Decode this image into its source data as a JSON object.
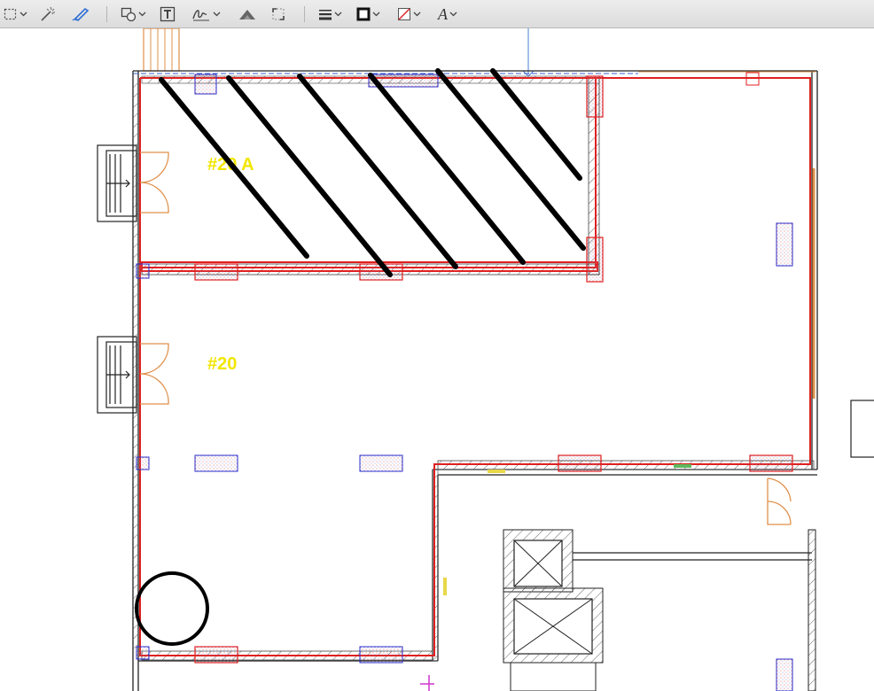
{
  "toolbar": {
    "tools": [
      {
        "name": "selection-tool",
        "icon": "dashed-rect-selection-icon",
        "has_menu": true
      },
      {
        "name": "instant-alpha-tool",
        "icon": "magic-wand-icon",
        "has_menu": false
      },
      {
        "name": "sketch-tool",
        "icon": "pen-sketch-icon",
        "has_menu": false,
        "active": true
      },
      {
        "name": "shapes-tool",
        "icon": "shapes-icon",
        "has_menu": true
      },
      {
        "name": "text-tool",
        "icon": "text-box-icon",
        "has_menu": false
      },
      {
        "name": "sign-tool",
        "icon": "signature-icon",
        "has_menu": true
      },
      {
        "name": "adjust-color-tool",
        "icon": "adjust-color-icon",
        "has_menu": false
      },
      {
        "name": "adjust-size-tool",
        "icon": "resize-icon",
        "has_menu": false
      },
      {
        "name": "shape-style-tool",
        "icon": "line-weight-icon",
        "has_menu": true
      },
      {
        "name": "border-color-tool",
        "icon": "border-color-icon",
        "has_menu": true
      },
      {
        "name": "fill-color-tool",
        "icon": "fill-color-icon",
        "has_menu": true
      },
      {
        "name": "text-style-tool",
        "icon": "font-style-icon",
        "has_menu": true
      }
    ],
    "font_glyph": "A",
    "accent_color": "#2f6fd6"
  },
  "floorplan": {
    "room_labels": [
      "#20 A",
      "#20"
    ],
    "room_label_color": "#f2e600",
    "wall_color": "#e02020",
    "column_color": "#2b2bc8",
    "hatch_color": "#555555"
  },
  "annotations": {
    "strike_lines": 6,
    "circle_marker": "black-circle",
    "stroke_color": "#000000"
  }
}
